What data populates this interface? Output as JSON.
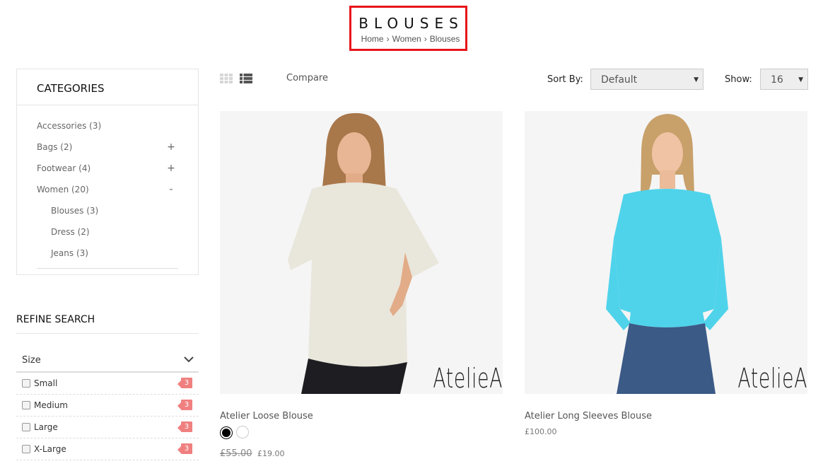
{
  "header": {
    "title": "BLOUSES",
    "breadcrumb": [
      "Home",
      "Women",
      "Blouses"
    ],
    "breadcrumb_separator": "›",
    "highlight_color": "#e8141b"
  },
  "categories": {
    "heading": "CATEGORIES",
    "items": [
      {
        "label": "Accessories (3)",
        "toggle": ""
      },
      {
        "label": "Bags (2)",
        "toggle": "+"
      },
      {
        "label": "Footwear (4)",
        "toggle": "+"
      },
      {
        "label": "Women (20)",
        "toggle": "-"
      },
      {
        "label": "Blouses (3)",
        "toggle": ""
      },
      {
        "label": "Dress (2)",
        "toggle": ""
      },
      {
        "label": "Jeans (3)",
        "toggle": ""
      }
    ]
  },
  "refine": {
    "heading": "REFINE SEARCH",
    "filter_name": "Size",
    "options": [
      {
        "label": "Small",
        "count": "3"
      },
      {
        "label": "Medium",
        "count": "3"
      },
      {
        "label": "Large",
        "count": "3"
      },
      {
        "label": "X-Large",
        "count": "3"
      }
    ],
    "badge_color": "#f08080"
  },
  "toolbar": {
    "compare": "Compare",
    "sort_label": "Sort By:",
    "sort_value": "Default",
    "show_label": "Show:",
    "show_value": "16",
    "grid_icon": "grid-view-icon",
    "list_icon": "list-view-icon"
  },
  "products": [
    {
      "name": "Atelier Loose Blouse",
      "brand": "AtelieA",
      "old_price": "£55.00",
      "price": "£19.00",
      "swatches": [
        "black",
        "white"
      ],
      "garment_color": "#e9e6dc"
    },
    {
      "name": "Atelier Long Sleeves Blouse",
      "brand": "AtelieA",
      "price": "£100.00",
      "garment_color": "#4fd3ea"
    }
  ]
}
